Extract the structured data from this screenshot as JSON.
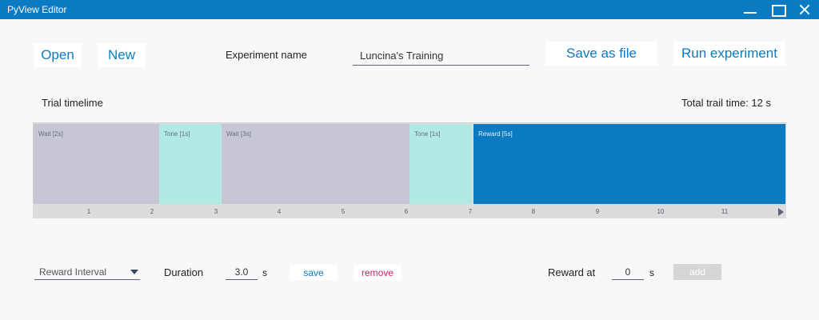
{
  "window": {
    "title": "PyView Editor",
    "controls": {
      "minimize_icon": "minimize-icon",
      "maximize_icon": "maximize-icon",
      "close_icon": "close-icon"
    }
  },
  "toolbar": {
    "open_label": "Open",
    "new_label": "New",
    "experiment_name_label": "Experiment name",
    "experiment_name_value": "Luncina's Training",
    "save_as_file_label": "Save as file",
    "run_experiment_label": "Run experiment"
  },
  "timeline": {
    "title": "Trial timelime",
    "total_time_label": "Total trail time: 12 s",
    "segments": [
      {
        "label": "Wait [2s]",
        "type": "wait",
        "duration": 2
      },
      {
        "label": "Tone [1s]",
        "type": "tone",
        "duration": 1
      },
      {
        "label": "Wait [3s]",
        "type": "wait",
        "duration": 3
      },
      {
        "label": "Tone [1s]",
        "type": "tone",
        "duration": 1
      },
      {
        "label": "Reward [5s]",
        "type": "reward",
        "duration": 5
      }
    ],
    "ticks": [
      "1",
      "2",
      "3",
      "4",
      "5",
      "6",
      "7",
      "8",
      "9",
      "10",
      "11"
    ],
    "colors": {
      "wait": "#c6c6d4",
      "tone": "#b0eae3",
      "reward": "#0a7bc2"
    }
  },
  "editor": {
    "interval_type": "Reward Interval",
    "duration_label": "Duration",
    "duration_value": "3.0",
    "duration_unit": "s",
    "save_label": "save",
    "remove_label": "remove",
    "reward_at_label": "Reward at",
    "reward_at_value": "0",
    "reward_at_unit": "s",
    "add_label": "add"
  },
  "colors": {
    "accent": "#0a7bc2",
    "danger": "#e5195f",
    "disabled": "#d6d6d6"
  }
}
